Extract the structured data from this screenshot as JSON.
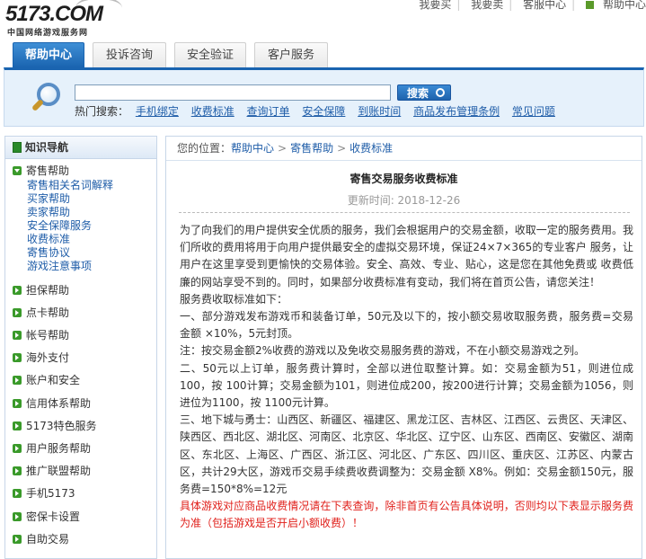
{
  "brand": {
    "logo_text": "5173.COM",
    "logo_sub": "中国网络游戏服务网"
  },
  "toplinks": [
    "我要买",
    "我要卖",
    "客服中心",
    "帮助中心"
  ],
  "tabs": [
    {
      "label": "帮助中心",
      "active": true
    },
    {
      "label": "投诉咨询",
      "active": false
    },
    {
      "label": "安全验证",
      "active": false
    },
    {
      "label": "客户服务",
      "active": false
    }
  ],
  "search": {
    "placeholder": "",
    "button_label": "搜索",
    "hot_label": "热门搜索：",
    "hot_links": [
      "手机绑定",
      "收费标准",
      "查询订单",
      "安全保障",
      "到账时间",
      "商品发布管理条例",
      "常见问题"
    ]
  },
  "sidebar": {
    "title": "知识导航",
    "expanded_category": "寄售帮助",
    "sub_items": [
      "寄售相关名词解释",
      "买家帮助",
      "卖家帮助",
      "安全保障服务",
      "收费标准",
      "寄售协议",
      "游戏注意事项"
    ],
    "categories": [
      "担保帮助",
      "点卡帮助",
      "帐号帮助",
      "海外支付",
      "账户和安全",
      "信用体系帮助",
      "5173特色服务",
      "用户服务帮助",
      "推广联盟帮助",
      "手机5173",
      "密保卡设置",
      "自助交易"
    ]
  },
  "breadcrumb": {
    "prefix": "您的位置：",
    "items": [
      "帮助中心",
      "寄售帮助",
      "收费标准"
    ]
  },
  "article": {
    "title": "寄售交易服务收费标准",
    "date": "更新时间: 2018-12-26",
    "paragraphs": [
      "为了向我们的用户提供安全优质的服务，我们会根据用户的交易金额，收取一定的服务费用。我 们所收的费用将用于向用户提供最安全的虚拟交易环境，保证24×7×365的专业客户 服务，让用户在这里享受到更愉快的交易体验。安全、高效、专业、贴心，这是您在其他免费或 收费低廉的网站享受不到的。同时，如果部分收费标准有变动，我们将在首页公告，请您关注！",
      "服务费收取标准如下：",
      "一、部分游戏发布游戏币和装备订单，50元及以下的，按小额交易收取服务费，服务费=交易金额 ×10%，5元封顶。",
      "注：按交易金额2%收费的游戏以及免收交易服务费的游戏，不在小额交易游戏之列。",
      "二、50元以上订单，服务费计算时，全部以进位取整计算。如：交易金额为51，则进位成100，按 100计算；交易金额为101，则进位成200，按200进行计算；交易金额为1056，则进位为1100，按 1100元计算。",
      "三、地下城与勇士：山西区、新疆区、福建区、黑龙江区、吉林区、江西区、云贵区、天津区、陕西区、西北区、湖北区、河南区、北京区、华北区、辽宁区、山东区、西南区、安徽区、湖南区、东北区、上海区、广西区、浙江区、河北区、广东区、四川区、重庆区、江苏区、内蒙古区，共计29大区，游戏币交易手续费收费调整为：交易金额 X8%。例如：交易金额150元，服务费=150*8%=12元"
    ],
    "red_note": "具体游戏对应商品收费情况请在下表查询，除非首页有公告具体说明，否则均以下表显示服务费为准（包括游戏是否开启小额收费）！"
  },
  "colors": {
    "accent": "#1a64b0",
    "link": "#1f5da8",
    "warning": "#e0201b"
  }
}
